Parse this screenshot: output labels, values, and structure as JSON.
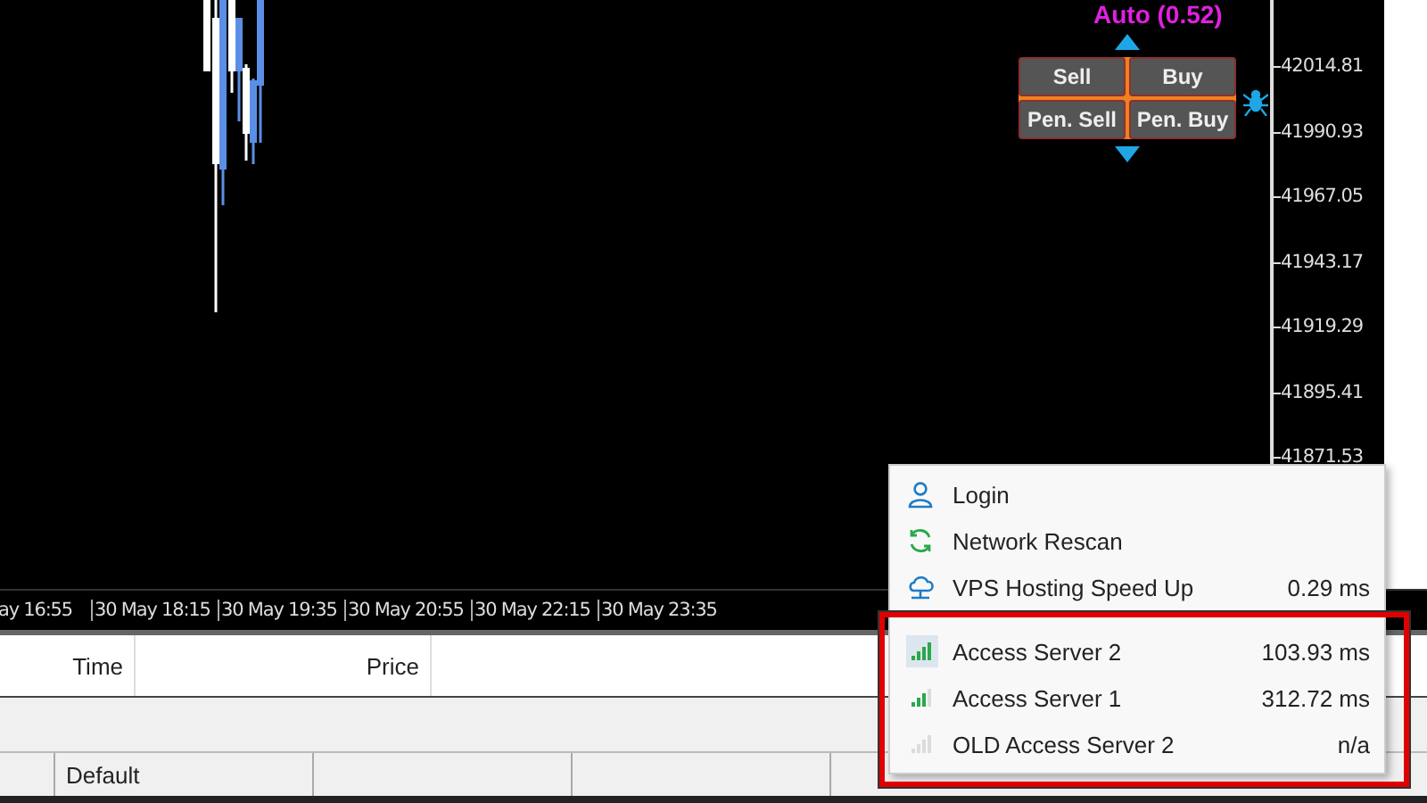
{
  "chart": {
    "mode_label": "Auto (0.52)",
    "price_labels": [
      "42014.81",
      "41990.93",
      "41967.05",
      "41943.17",
      "41919.29",
      "41895.41",
      "41871.53"
    ],
    "time_labels": [
      "ay 16:55",
      "30 May 18:15",
      "30 May 19:35",
      "30 May 20:55",
      "30 May 22:15",
      "30 May 23:35"
    ]
  },
  "trade_panel": {
    "buttons": [
      {
        "label": "Sell"
      },
      {
        "label": "Buy"
      },
      {
        "label": "Pen. Sell"
      },
      {
        "label": "Pen. Buy"
      }
    ]
  },
  "table": {
    "columns": [
      "Time",
      "Price"
    ]
  },
  "status_bar": {
    "profile": "Default"
  },
  "connection_menu": {
    "items": [
      {
        "kind": "login",
        "label": "Login"
      },
      {
        "kind": "rescan",
        "label": "Network Rescan"
      },
      {
        "kind": "vps",
        "label": "VPS Hosting Speed Up",
        "value": "0.29 ms"
      },
      {
        "kind": "strong",
        "label": "Access Server 2",
        "value": "103.93 ms",
        "selected": true
      },
      {
        "kind": "medium",
        "label": "Access Server 1",
        "value": "312.72 ms",
        "selected": false
      },
      {
        "kind": "offline",
        "label": "OLD Access Server 2",
        "value": "n/a",
        "selected": false
      }
    ]
  }
}
